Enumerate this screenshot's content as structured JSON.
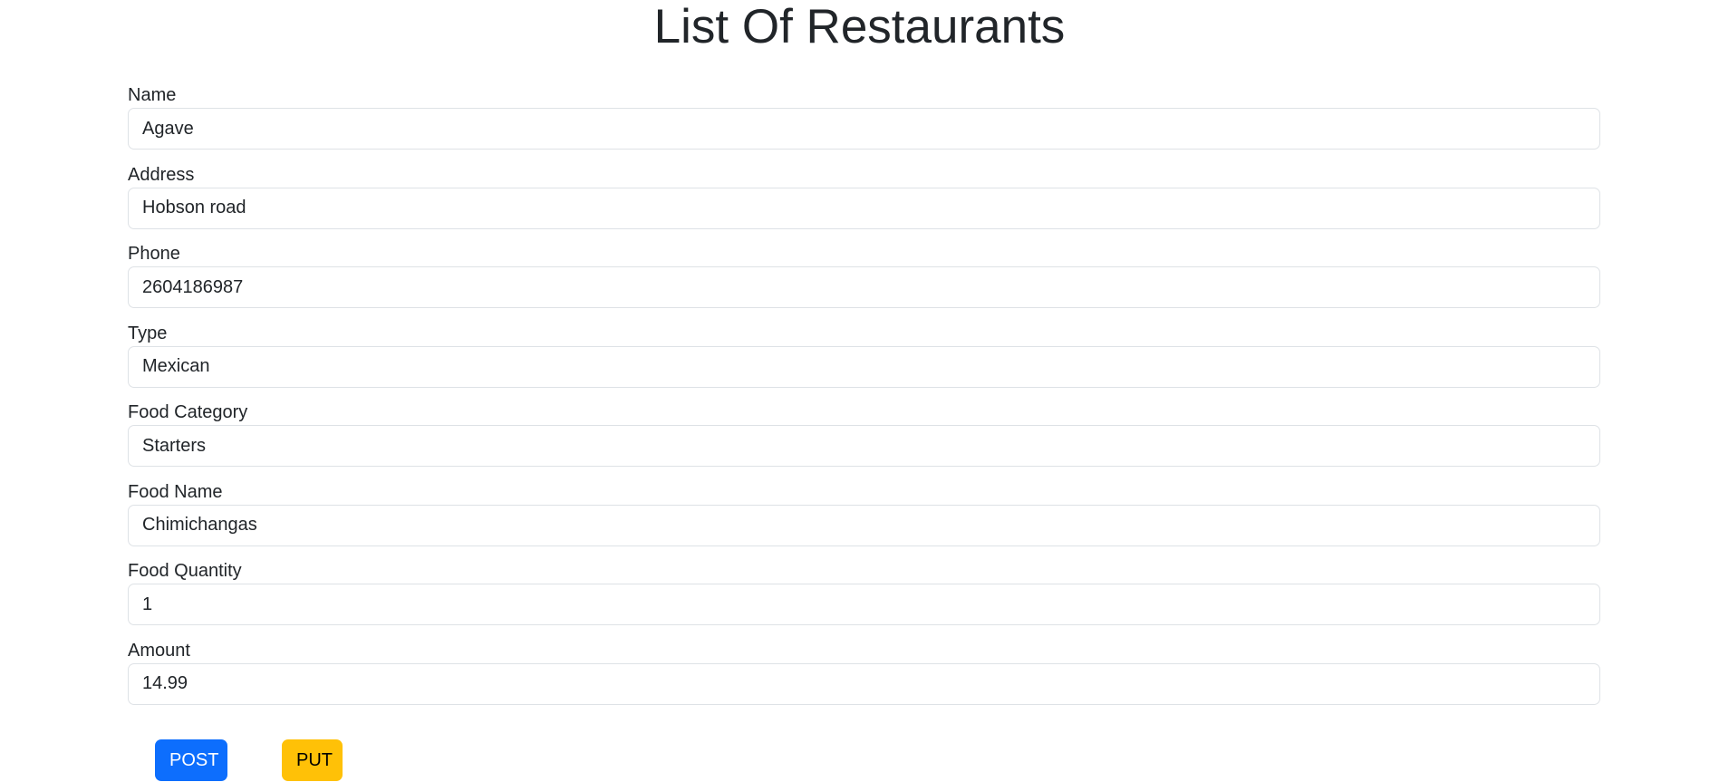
{
  "page": {
    "title": "List Of Restaurants"
  },
  "form": {
    "fields": [
      {
        "label": "Name",
        "value": "Agave"
      },
      {
        "label": "Address",
        "value": "Hobson road"
      },
      {
        "label": "Phone",
        "value": "2604186987"
      },
      {
        "label": "Type",
        "value": "Mexican"
      },
      {
        "label": "Food Category",
        "value": "Starters"
      },
      {
        "label": "Food Name",
        "value": "Chimichangas"
      },
      {
        "label": "Food Quantity",
        "value": "1"
      },
      {
        "label": "Amount",
        "value": "14.99"
      }
    ]
  },
  "actions": {
    "post_label": "POST",
    "put_label": "PUT"
  },
  "colors": {
    "post_button": "#0d6efd",
    "put_button": "#ffc107",
    "input_border": "#dee2e6",
    "text": "#212529"
  }
}
